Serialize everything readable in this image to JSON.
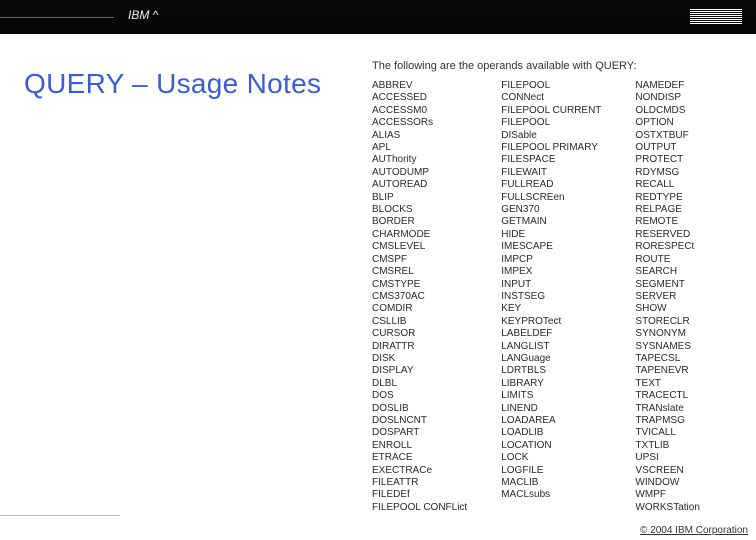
{
  "header": {
    "brand_left": "IBM ^"
  },
  "title": "QUERY – Usage Notes",
  "intro": "The following are the operands available with QUERY:",
  "columns": {
    "c1": [
      "ABBREV",
      "ACCESSED",
      "ACCESSM0",
      "ACCESSORs",
      "ALIAS",
      "APL",
      "AUThority",
      "AUTODUMP",
      "AUTOREAD",
      "BLIP",
      "BLOCKS",
      "BORDER",
      "CHARMODE",
      "CMSLEVEL",
      "CMSPF",
      "CMSREL",
      "CMSTYPE",
      "CMS370AC",
      "COMDIR",
      "CSLLIB",
      "CURSOR",
      "DIRATTR",
      "DISK",
      "DISPLAY",
      "DLBL",
      "DOS",
      "DOSLIB",
      "DOSLNCNT",
      "DOSPART",
      "ENROLL",
      "ETRACE",
      "EXECTRACe",
      "FILEATTR",
      "FILEDEf",
      "FILEPOOL CONFLict"
    ],
    "c2": [
      "FILEPOOL",
      "CONNect",
      "FILEPOOL CURRENT",
      "FILEPOOL",
      "DISable",
      "FILEPOOL PRIMARY",
      "FILESPACE",
      "FILEWAIT",
      "FULLREAD",
      "FULLSCREen",
      "GEN370",
      "GETMAIN",
      "HIDE",
      "IMESCAPE",
      "IMPCP",
      "IMPEX",
      "INPUT",
      "INSTSEG",
      "KEY",
      "KEYPROTect",
      "LABELDEF",
      "LANGLIST",
      "LANGuage",
      "LDRTBLS",
      "LIBRARY",
      "LIMITS",
      "LINEND",
      "LOADAREA",
      "LOADLIB",
      "LOCATION",
      "LOCK",
      "LOGFILE",
      "MACLIB",
      "MACLsubs"
    ],
    "c3": [
      "NAMEDEF",
      "NONDISP",
      "OLDCMDS",
      "OPTION",
      "OSTXTBUF",
      "OUTPUT",
      "PROTECT",
      "RDYMSG",
      "RECALL",
      "REDTYPE",
      "RELPAGE",
      "REMOTE",
      "RESERVED",
      "RORESPECt",
      "ROUTE",
      "SEARCH",
      "SEGMENT",
      "SERVER",
      "SHOW",
      "STORECLR",
      "SYNONYM",
      "SYSNAMES",
      "TAPECSL",
      "TAPENEVR",
      "TEXT",
      "TRACECTL",
      "TRANslate",
      "TRAPMSG",
      "TVICALL",
      "TXTLIB",
      "UPSI",
      "VSCREEN",
      "WINDOW",
      "WMPF",
      "WORKSTation"
    ]
  },
  "footer": {
    "copyright": "© 2004 IBM Corporation"
  }
}
